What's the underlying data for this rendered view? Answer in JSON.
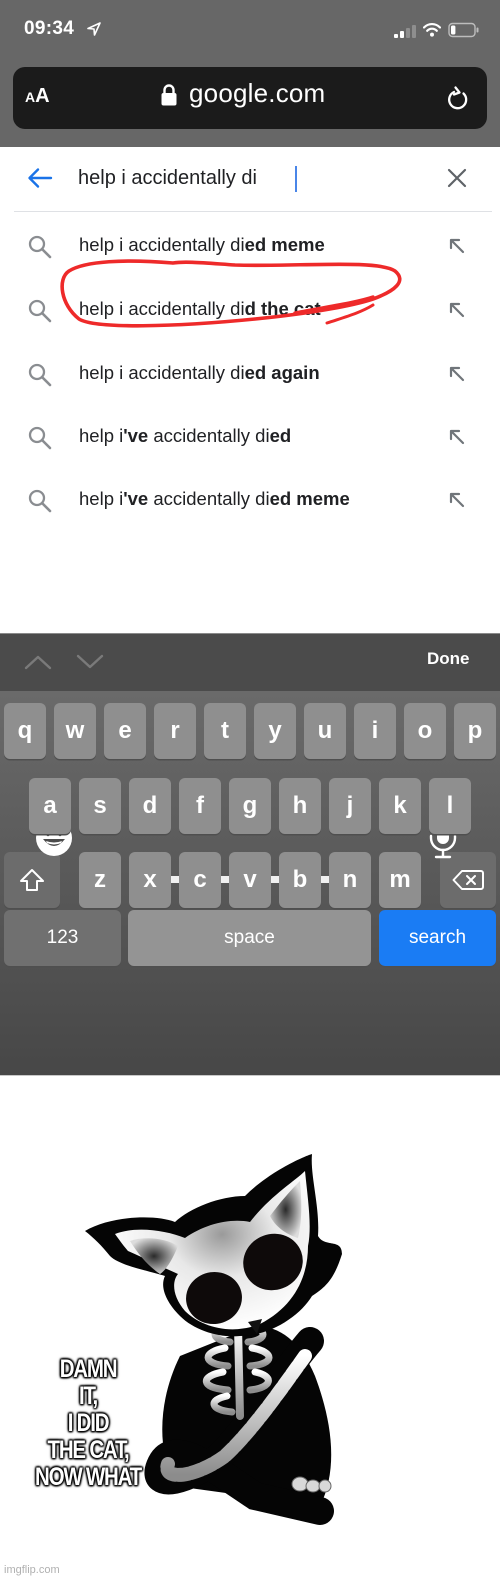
{
  "status_bar": {
    "time": "09:34",
    "location_icon": "location-arrow-icon",
    "signal_bars_active": 2,
    "signal_bars_total": 4,
    "wifi_icon": "wifi-icon",
    "battery_level_percent": 20
  },
  "url_bar": {
    "text_size_small": "A",
    "text_size_big": "A",
    "lock_icon": "lock-icon",
    "domain": "google.com",
    "reload_icon": "reload-icon"
  },
  "search": {
    "back_icon": "back-arrow-icon",
    "query": "help i accidentally di",
    "clear_icon": "close-icon",
    "suggestions": [
      {
        "prefix": "help i accidentally di",
        "bold": "ed meme",
        "suffix": "",
        "full": "help i accidentally died meme"
      },
      {
        "prefix": "help i accidentally di",
        "bold": "d the cat",
        "suffix": "",
        "full": "help i accidentally did the cat",
        "annotated": true
      },
      {
        "prefix": "help i accidentally di",
        "bold": "ed again",
        "suffix": "",
        "full": "help i accidentally died again"
      },
      {
        "prefix": "help i",
        "bold": "'ve",
        "suffix": " accidentally di",
        "bold2": "ed",
        "suffix2": "",
        "full": "help i've accidentally died"
      },
      {
        "prefix": "help i",
        "bold": "'ve",
        "suffix": " accidentally di",
        "bold2": "ed meme",
        "suffix2": "",
        "full": "help i've accidentally died meme"
      }
    ],
    "annotation_color": "#ee2a2a"
  },
  "keyboard": {
    "toolbar": {
      "prev_icon": "chevron-up-icon",
      "next_icon": "chevron-down-icon",
      "done_label": "Done"
    },
    "rows": [
      [
        "q",
        "w",
        "e",
        "r",
        "t",
        "y",
        "u",
        "i",
        "o",
        "p"
      ],
      [
        "a",
        "s",
        "d",
        "f",
        "g",
        "h",
        "j",
        "k",
        "l"
      ],
      [
        "z",
        "x",
        "c",
        "v",
        "b",
        "n",
        "m"
      ]
    ],
    "shift_icon": "shift-icon",
    "delete_icon": "backspace-icon",
    "numbers_label": "123",
    "space_label": "space",
    "search_label": "search",
    "search_color": "#1a7cf4",
    "emoji_icon": "emoji-icon",
    "mic_icon": "microphone-icon"
  },
  "meme": {
    "caption_lines": [
      "DAMN",
      "IT,",
      "I DID",
      "THE CAT,",
      "NOW WHAT"
    ],
    "image": "skeleton-cat-illustration",
    "watermark": "imgflip.com"
  }
}
